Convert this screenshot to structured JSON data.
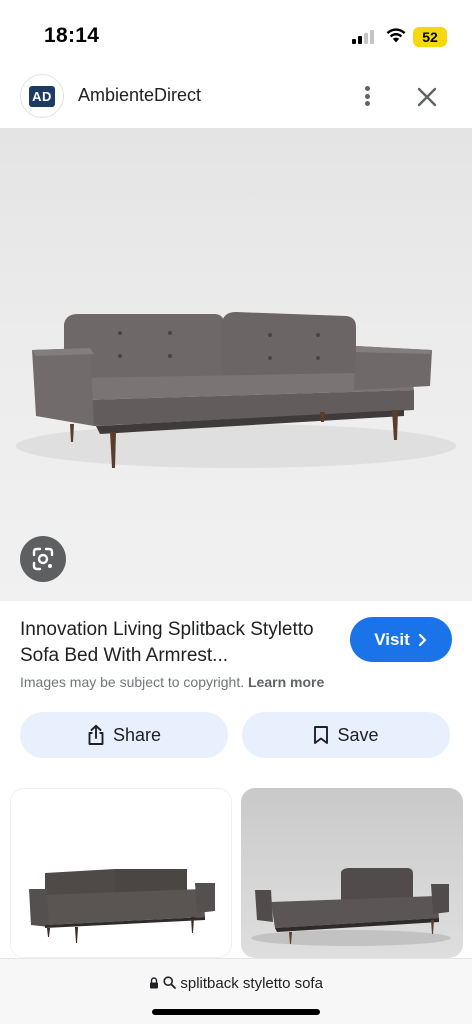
{
  "status_bar": {
    "time": "18:14",
    "battery": "52",
    "icons": [
      "signal-icon",
      "wifi-icon",
      "battery-icon"
    ]
  },
  "site": {
    "logo_text": "AD",
    "name": "AmbienteDirect",
    "icons": [
      "more-vert-icon",
      "close-icon"
    ]
  },
  "result": {
    "title": "Innovation Living Splitback Styletto Sofa Bed With Armrest...",
    "visit_label": "Visit",
    "copyright": "Images may be subject to copyright.",
    "learn_more": "Learn more"
  },
  "actions": {
    "share_label": "Share",
    "save_label": "Save"
  },
  "search": {
    "query": "splitback styletto sofa"
  },
  "colors": {
    "accent": "#1a73e8",
    "action_bg": "#e8f0fe",
    "sofa_fabric": "#6e6868",
    "legs": "#5b3d2c",
    "logo_bg": "#1c3a63",
    "battery": "#f5d90a"
  }
}
